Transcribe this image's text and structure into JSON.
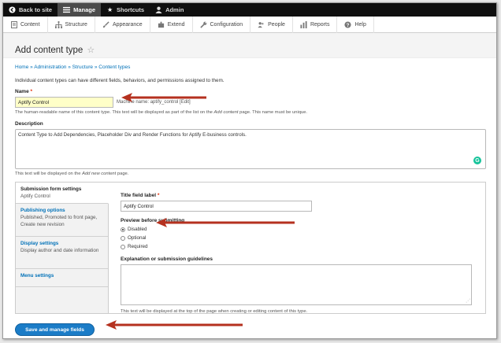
{
  "toolbar": {
    "back": "Back to site",
    "manage": "Manage",
    "shortcuts": "Shortcuts",
    "admin": "Admin"
  },
  "tray": [
    "Content",
    "Structure",
    "Appearance",
    "Extend",
    "Configuration",
    "People",
    "Reports",
    "Help"
  ],
  "page": {
    "title": "Add content type",
    "breadcrumb": [
      "Home",
      "Administration",
      "Structure",
      "Content types"
    ],
    "breadcrumb_sep": "»",
    "intro": "Individual content types can have different fields, behaviors, and permissions assigned to them."
  },
  "name": {
    "label": "Name",
    "required_mark": "*",
    "value": "Aptify Control",
    "machine_name": "Machine name: aptify_control [Edit]",
    "help_before": "The human-readable name of this content type. This text will be displayed as part of the list on the ",
    "help_em": "Add content",
    "help_after": " page. This name must be unique."
  },
  "description": {
    "label": "Description",
    "value": "Content Type to Add Dependencies, Placeholder Div and Render Functions for Aptify E-business controls.",
    "help_before": "This text will be displayed on the ",
    "help_em": "Add new content",
    "help_after": " page."
  },
  "tabs": [
    {
      "title": "Submission form settings",
      "summary": "Aptify Control"
    },
    {
      "title": "Publishing options",
      "summary": "Published, Promoted to front page, Create new revision"
    },
    {
      "title": "Display settings",
      "summary": "Display author and date information"
    },
    {
      "title": "Menu settings",
      "summary": ""
    }
  ],
  "submission": {
    "title_label": "Title field label",
    "required_mark": "*",
    "title_value": "Aptify Control",
    "preview_label": "Preview before submitting",
    "preview_options": [
      "Disabled",
      "Optional",
      "Required"
    ],
    "preview_selected": "Disabled",
    "guidelines_label": "Explanation or submission guidelines",
    "guidelines_value": "",
    "guidelines_help": "This text will be displayed at the top of the page when creating or editing content of this type."
  },
  "submit_label": "Save and manage fields",
  "annotation_color": "#b5311f"
}
